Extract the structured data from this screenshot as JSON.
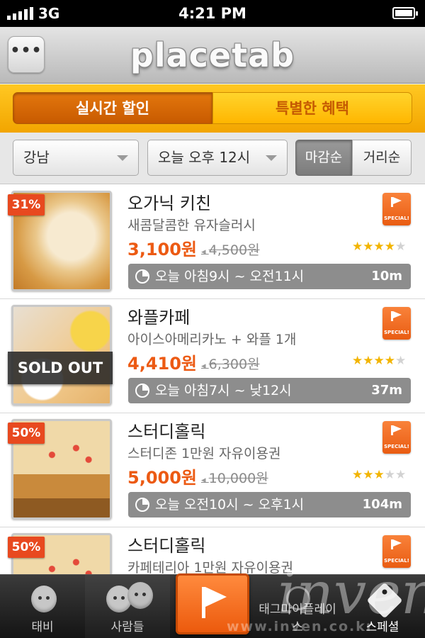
{
  "status": {
    "carrier": "3G",
    "time": "4:21 PM"
  },
  "nav": {
    "menu_label": "•••",
    "logo": "placetab"
  },
  "segments": [
    "실시간 할인",
    "특별한 혜택"
  ],
  "filters": {
    "region": "강남",
    "time": "오늘 오후 12시",
    "sort": [
      "마감순",
      "거리순"
    ]
  },
  "deals": [
    {
      "badge": "31%",
      "name": "오가닉 키친",
      "desc": "새콤달콤한 유자슬러시",
      "price": "3,100원",
      "orig_price": "4,500원",
      "rating": 4,
      "time": "오늘 아침9시 ~ 오전11시",
      "distance": "10m",
      "special": "SPECIAL!"
    },
    {
      "badge": "SOLD OUT",
      "name": "와플카페",
      "desc": "아이스아메리카노 + 와플 1개",
      "price": "4,410원",
      "orig_price": "6,300원",
      "rating": 4,
      "time": "오늘 아침7시 ~ 낮12시",
      "distance": "37m",
      "special": "SPECIAL!"
    },
    {
      "badge": "50%",
      "name": "스터디홀릭",
      "desc": "스터디존 1만원 자유이용권",
      "price": "5,000원",
      "orig_price": "10,000원",
      "rating": 3,
      "time": "오늘 오전10시 ~ 오후1시",
      "distance": "104m",
      "special": "SPECIAL!"
    },
    {
      "badge": "50%",
      "name": "스터디홀릭",
      "desc": "카페테리아 1만원 자유이용권",
      "special": "SPECIAL!"
    }
  ],
  "tabs": [
    {
      "label": "태비",
      "icon": "face-icon"
    },
    {
      "label": "사람들",
      "icon": "people-icon"
    },
    {
      "label": "",
      "icon": "flag-icon"
    },
    {
      "label": "태그마이플레이스",
      "icon": "person-icon"
    },
    {
      "label": "스페셜",
      "icon": "tag-icon"
    }
  ],
  "watermark": {
    "text": "inven",
    "url": "www.inven.co.kr"
  },
  "colors": {
    "accent": "#ec5a13",
    "segment_bg": "#f5b000",
    "tab_bar": "#1f1f1f"
  }
}
